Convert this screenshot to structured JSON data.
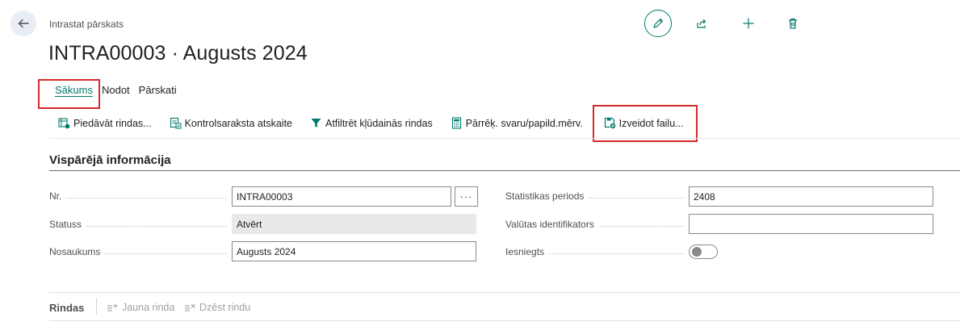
{
  "header": {
    "breadcrumb": "Intrastat pārskats",
    "title": "INTRA00003 · Augusts 2024",
    "actions": {
      "edit": "pencil-icon",
      "share": "share-icon",
      "new": "plus-icon",
      "delete": "trash-icon"
    }
  },
  "tabs": [
    {
      "label": "Sākums",
      "active": true
    },
    {
      "label": "Nodot"
    },
    {
      "label": "Pārskati"
    }
  ],
  "toolbar": {
    "suggest_lines": "Piedāvāt rindas...",
    "checklist_report": "Kontrolsaraksta atskaite",
    "filter_error_lines": "Atfiltrēt kļūdainās rindas",
    "recalc_weight": "Pārrēķ. svaru/papild.mērv.",
    "create_file": "Izveidot failu..."
  },
  "general": {
    "section_title": "Vispārējā informācija",
    "no_label": "Nr.",
    "no_value": "INTRA00003",
    "lookup_label": "···",
    "status_label": "Statuss",
    "status_value": "Atvērt",
    "description_label": "Nosaukums",
    "description_value": "Augusts 2024",
    "stat_period_label": "Statistikas periods",
    "stat_period_value": "2408",
    "currency_label": "Valūtas identifikators",
    "currency_value": "",
    "reported_label": "Iesniegts",
    "reported_value": false
  },
  "lines": {
    "title": "Rindas",
    "new_line": "Jauna rinda",
    "delete_line": "Dzēst rindu"
  },
  "colors": {
    "accent": "#00796b",
    "highlight": "#d62929"
  }
}
